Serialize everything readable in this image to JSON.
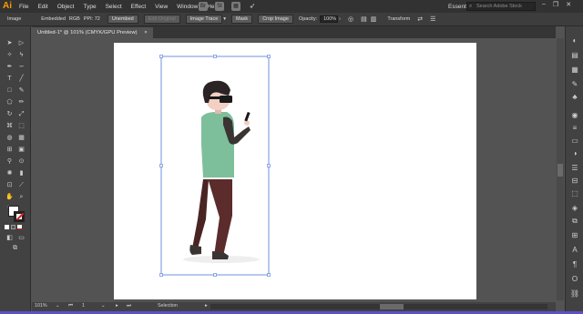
{
  "app": {
    "logo": "Ai"
  },
  "menubar": {
    "items": [
      "File",
      "Edit",
      "Object",
      "Type",
      "Select",
      "Effect",
      "View",
      "Window",
      "Help"
    ],
    "workspace": "Essentials ⌄",
    "search_placeholder": "Search Adobe Stock",
    "window_controls": [
      "–",
      "❐",
      "✕"
    ]
  },
  "controlbar": {
    "object_type": "Image",
    "embedded": "Embedded",
    "color_mode": "RGB",
    "ppi": "PPI: 72",
    "unembed": "Unembed",
    "edit_original": "Edit Original",
    "image_trace": "Image Trace",
    "mask": "Mask",
    "crop_image": "Crop Image",
    "opacity_label": "Opacity:",
    "opacity_value": "100%",
    "transform": "Transform"
  },
  "document": {
    "tab_title": "Untitled-1* @ 101% (CMYK/GPU Preview)",
    "tab_close": "×"
  },
  "statusbar": {
    "zoom": "101%",
    "page": "1",
    "tool": "Selection"
  },
  "colors": {
    "shirt": "#7dbf9a",
    "sleeves": "#3a3433",
    "pants": "#5b2c2b",
    "hair": "#2a2524",
    "skin": "#f3cfc4",
    "goggles": "#1a1a1a",
    "selection": "#4a78d6"
  }
}
